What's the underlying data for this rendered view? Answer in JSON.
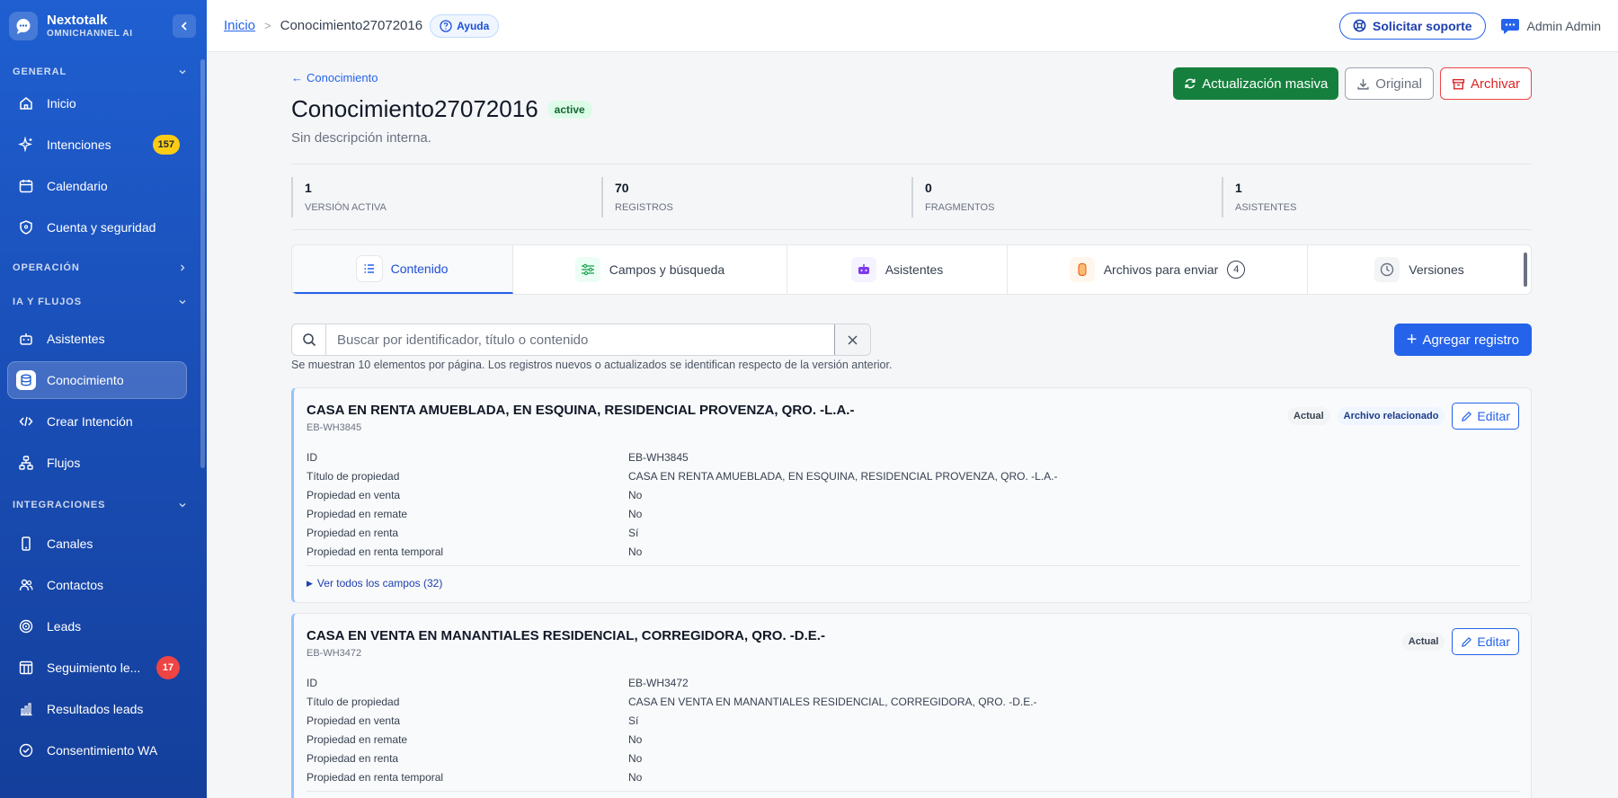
{
  "brand": {
    "name": "Nextotalk",
    "subtitle": "OMNICHANNEL AI"
  },
  "sidebar": {
    "sections": {
      "general": "GENERAL",
      "operacion": "OPERACIÓN",
      "ia": "IA Y FLUJOS",
      "integraciones": "INTEGRACIONES"
    },
    "items": {
      "inicio": "Inicio",
      "intenciones": "Intenciones",
      "intenciones_badge": "157",
      "calendario": "Calendario",
      "cuenta": "Cuenta y seguridad",
      "asistentes": "Asistentes",
      "conocimiento": "Conocimiento",
      "crear": "Crear Intención",
      "flujos": "Flujos",
      "canales": "Canales",
      "contactos": "Contactos",
      "leads": "Leads",
      "seguimiento": "Seguimiento le...",
      "seguimiento_badge": "17",
      "resultados": "Resultados leads",
      "consentimiento": "Consentimiento WA"
    }
  },
  "topbar": {
    "breadcrumb_home": "Inicio",
    "breadcrumb_sep": ">",
    "breadcrumb_current": "Conocimiento27072016",
    "help": "Ayuda",
    "support": "Solicitar soporte",
    "user": "Admin Admin"
  },
  "page": {
    "back": "Conocimiento",
    "title": "Conocimiento27072016",
    "status": "active",
    "description": "Sin descripción interna.",
    "btn_bulk": "Actualización masiva",
    "btn_original": "Original",
    "btn_archive": "Archivar"
  },
  "stats": [
    {
      "value": "1",
      "label": "VERSIÓN ACTIVA"
    },
    {
      "value": "70",
      "label": "REGISTROS"
    },
    {
      "value": "0",
      "label": "FRAGMENTOS"
    },
    {
      "value": "1",
      "label": "ASISTENTES"
    }
  ],
  "tabs": {
    "contenido": "Contenido",
    "campos": "Campos y búsqueda",
    "asistentes": "Asistentes",
    "archivos": "Archivos para enviar",
    "archivos_count": "4",
    "versiones": "Versiones"
  },
  "search": {
    "placeholder": "Buscar por identificador, título o contenido",
    "value": "",
    "add_button": "Agregar registro",
    "hint": "Se muestran 10 elementos por página. Los registros nuevos o actualizados se identifican respecto de la versión anterior."
  },
  "records": [
    {
      "title": "CASA EN RENTA AMUEBLADA, EN ESQUINA, RESIDENCIAL PROVENZA, QRO. -L.A.-",
      "code": "EB-WH3845",
      "tag_current": "Actual",
      "tag_file": "Archivo relacionado",
      "edit": "Editar",
      "fields": [
        {
          "label": "ID",
          "value": "EB-WH3845"
        },
        {
          "label": "Título de propiedad",
          "value": "CASA EN RENTA AMUEBLADA, EN ESQUINA, RESIDENCIAL PROVENZA, QRO. -L.A.-"
        },
        {
          "label": "Propiedad en venta",
          "value": "No"
        },
        {
          "label": "Propiedad en remate",
          "value": "No"
        },
        {
          "label": "Propiedad en renta",
          "value": "Sí"
        },
        {
          "label": "Propiedad en renta temporal",
          "value": "No"
        }
      ],
      "see_all": "Ver todos los campos (32)"
    },
    {
      "title": "CASA EN VENTA EN MANANTIALES RESIDENCIAL, CORREGIDORA, QRO. -D.E.-",
      "code": "EB-WH3472",
      "tag_current": "Actual",
      "edit": "Editar",
      "fields": [
        {
          "label": "ID",
          "value": "EB-WH3472"
        },
        {
          "label": "Título de propiedad",
          "value": "CASA EN VENTA EN MANANTIALES RESIDENCIAL, CORREGIDORA, QRO. -D.E.-"
        },
        {
          "label": "Propiedad en venta",
          "value": "Sí"
        },
        {
          "label": "Propiedad en remate",
          "value": "No"
        },
        {
          "label": "Propiedad en renta",
          "value": "No"
        },
        {
          "label": "Propiedad en renta temporal",
          "value": "No"
        }
      ]
    }
  ],
  "colors": {
    "sidebar": "#1f5fd1",
    "accent": "#2563eb",
    "success": "#15803d",
    "danger": "#ef4444"
  }
}
